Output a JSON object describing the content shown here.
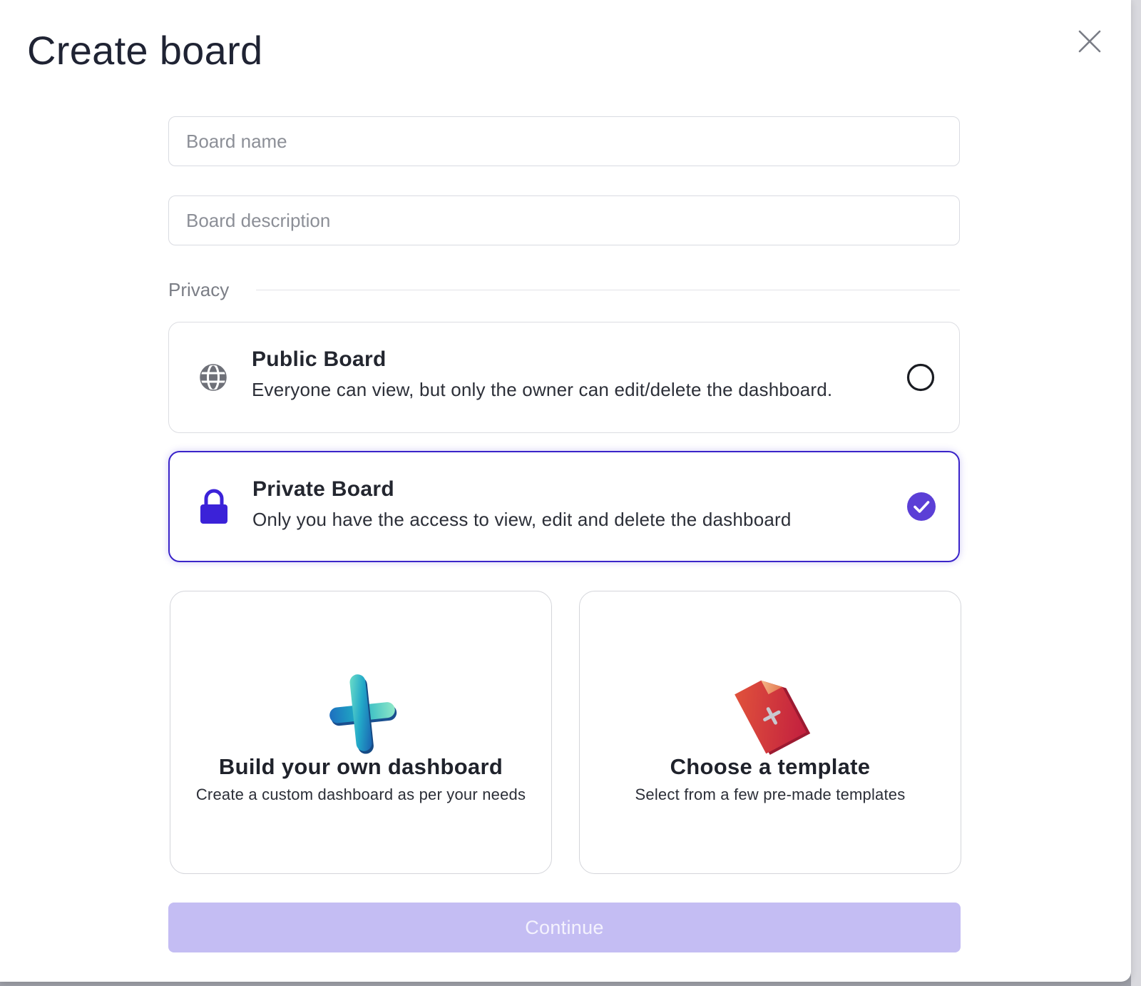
{
  "dialog": {
    "title": "Create board",
    "close_icon": "close-icon"
  },
  "form": {
    "board_name": {
      "value": "",
      "placeholder": "Board name"
    },
    "board_description": {
      "value": "",
      "placeholder": "Board description"
    }
  },
  "privacy": {
    "section_label": "Privacy",
    "selected": "private",
    "options": [
      {
        "id": "public",
        "icon": "globe-icon",
        "title": "Public Board",
        "description": "Everyone can view, but only the owner can edit/delete the dashboard.",
        "selected": false
      },
      {
        "id": "private",
        "icon": "lock-icon",
        "title": "Private Board",
        "description": "Only you have the access to view, edit and delete the dashboard",
        "selected": true
      }
    ]
  },
  "creation_options": [
    {
      "id": "build",
      "icon": "plus-3d-icon",
      "title": "Build your own dashboard",
      "description": "Create a custom dashboard as per your needs"
    },
    {
      "id": "template",
      "icon": "template-document-icon",
      "title": "Choose a template",
      "description": "Select from a few pre-made templates"
    }
  ],
  "actions": {
    "continue_label": "Continue",
    "continue_enabled": false
  },
  "colors": {
    "accent": "#5b3fd6",
    "accent_border": "#3a24c9",
    "lock": "#3b22d8",
    "continue_disabled": "#c4bdf3"
  }
}
